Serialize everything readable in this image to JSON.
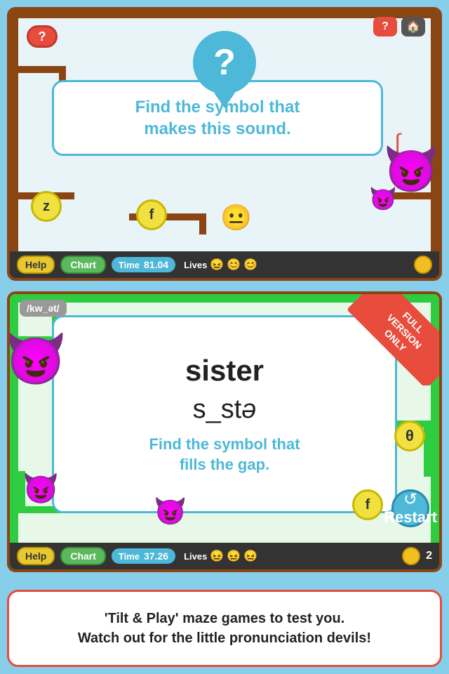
{
  "top_panel": {
    "help_button": "?",
    "header_question": "?",
    "instruction_line1": "Find the symbol that",
    "instruction_line2": "makes this sound.",
    "token_z": "z",
    "token_f": "f",
    "bottom_bar": {
      "help_label": "Help",
      "chart_label": "Chart",
      "time_label": "Time",
      "time_value": "81.04",
      "lives_label": "Lives",
      "life_icons": [
        "😖",
        "😊",
        "😊"
      ]
    }
  },
  "bottom_panel": {
    "phonetic_tag": "/kw_ət/",
    "full_version_line1": "FULL",
    "full_version_line2": "VERSION",
    "full_version_line3": "ONLY",
    "word": "sister",
    "phonetic": "s_stə",
    "instruction_line1": "Find the symbol that",
    "instruction_line2": "fills the gap.",
    "theta_token": "θ",
    "f_token": "f",
    "restart_label": "Restart",
    "bottom_bar": {
      "help_label": "Help",
      "chart_label": "Chart",
      "time_label": "Time",
      "time_value": "37.26",
      "lives_label": "Lives",
      "life_icons": [
        "😖",
        "😖",
        "😖"
      ],
      "coin_count": "2"
    }
  },
  "caption": {
    "line1": "'Tilt & Play' maze games to test you.",
    "line2": "Watch out for the little pronunciation devils!"
  },
  "icons": {
    "question_mark": "?",
    "home": "🏠",
    "restart": "↺",
    "coin": "🟡",
    "devil_emoji": "😈"
  }
}
